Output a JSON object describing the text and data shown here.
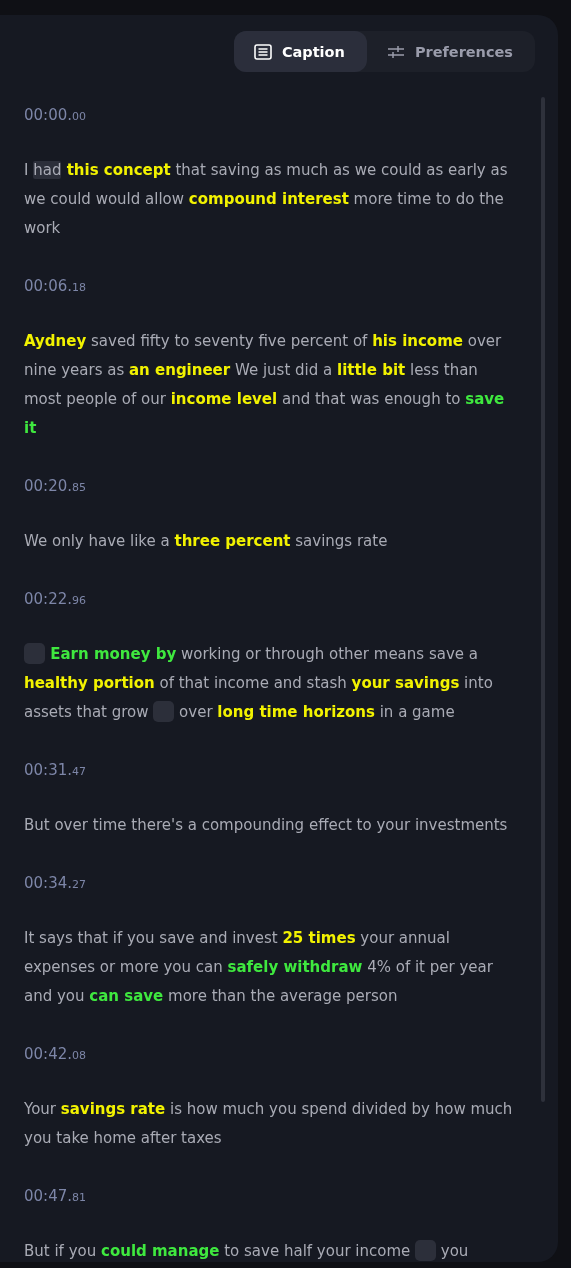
{
  "tabs": [
    {
      "label": "Caption",
      "kind": "document",
      "selected": true
    },
    {
      "label": "Preferences",
      "kind": "sliders",
      "selected": false
    }
  ],
  "captions": [
    {
      "time": "00:00.",
      "hundredths": "00",
      "parts": [
        {
          "kind": "plain",
          "text": "I "
        },
        {
          "kind": "focus",
          "text": "had"
        },
        {
          "kind": "key",
          "text": " this concept"
        },
        {
          "kind": "plain",
          "text": " that saving as much as we could as early as we could would allow "
        },
        {
          "kind": "key",
          "text": "compound interest"
        },
        {
          "kind": "plain",
          "text": " more time to do the work"
        }
      ]
    },
    {
      "time": "00:06.",
      "hundredths": "18",
      "parts": [
        {
          "kind": "key",
          "text": "Aydney"
        },
        {
          "kind": "plain",
          "text": " saved fifty to seventy five percent of "
        },
        {
          "kind": "key",
          "text": "his income"
        },
        {
          "kind": "plain",
          "text": " over nine years as "
        },
        {
          "kind": "key",
          "text": "an engineer"
        },
        {
          "kind": "plain",
          "text": " We just did a "
        },
        {
          "kind": "key",
          "text": "little bit"
        },
        {
          "kind": "plain",
          "text": " less than most people of our "
        },
        {
          "kind": "key",
          "text": "income level"
        },
        {
          "kind": "plain",
          "text": " and that was enough to "
        },
        {
          "kind": "action",
          "text": "save it"
        }
      ]
    },
    {
      "time": "00:20.",
      "hundredths": "85",
      "parts": [
        {
          "kind": "plain",
          "text": "We only have like a "
        },
        {
          "kind": "key",
          "text": "three percent"
        },
        {
          "kind": "plain",
          "text": " savings rate"
        }
      ]
    },
    {
      "time": "00:22.",
      "hundredths": "96",
      "parts": [
        {
          "kind": "gap"
        },
        {
          "kind": "action",
          "text": " Earn money by"
        },
        {
          "kind": "plain",
          "text": " working or through other means save a "
        },
        {
          "kind": "key",
          "text": "healthy portion"
        },
        {
          "kind": "plain",
          "text": " of that income and stash "
        },
        {
          "kind": "key",
          "text": "your savings"
        },
        {
          "kind": "plain",
          "text": " into assets that grow "
        },
        {
          "kind": "gap"
        },
        {
          "kind": "plain",
          "text": " over "
        },
        {
          "kind": "key",
          "text": "long time horizons"
        },
        {
          "kind": "plain",
          "text": " in a game"
        }
      ]
    },
    {
      "time": "00:31.",
      "hundredths": "47",
      "parts": [
        {
          "kind": "plain",
          "text": "But over time there's a compounding effect to your investments"
        }
      ]
    },
    {
      "time": "00:34.",
      "hundredths": "27",
      "parts": [
        {
          "kind": "plain",
          "text": "It says that if you save and invest "
        },
        {
          "kind": "key",
          "text": "25 times"
        },
        {
          "kind": "plain",
          "text": " your annual expenses or more you can "
        },
        {
          "kind": "action",
          "text": "safely withdraw"
        },
        {
          "kind": "plain",
          "text": " 4% of it per year and you "
        },
        {
          "kind": "action",
          "text": "can save"
        },
        {
          "kind": "plain",
          "text": " more than the average person"
        }
      ]
    },
    {
      "time": "00:42.",
      "hundredths": "08",
      "parts": [
        {
          "kind": "plain",
          "text": "Your "
        },
        {
          "kind": "key",
          "text": "savings rate"
        },
        {
          "kind": "plain",
          "text": " is how much you spend divided by how much you take home after taxes"
        }
      ]
    },
    {
      "time": "00:47.",
      "hundredths": "81",
      "parts": [
        {
          "kind": "plain",
          "text": "But if you "
        },
        {
          "kind": "action",
          "text": "could manage"
        },
        {
          "kind": "plain",
          "text": " to save half your income "
        },
        {
          "kind": "gap"
        },
        {
          "kind": "plain",
          "text": " you"
        }
      ]
    }
  ]
}
